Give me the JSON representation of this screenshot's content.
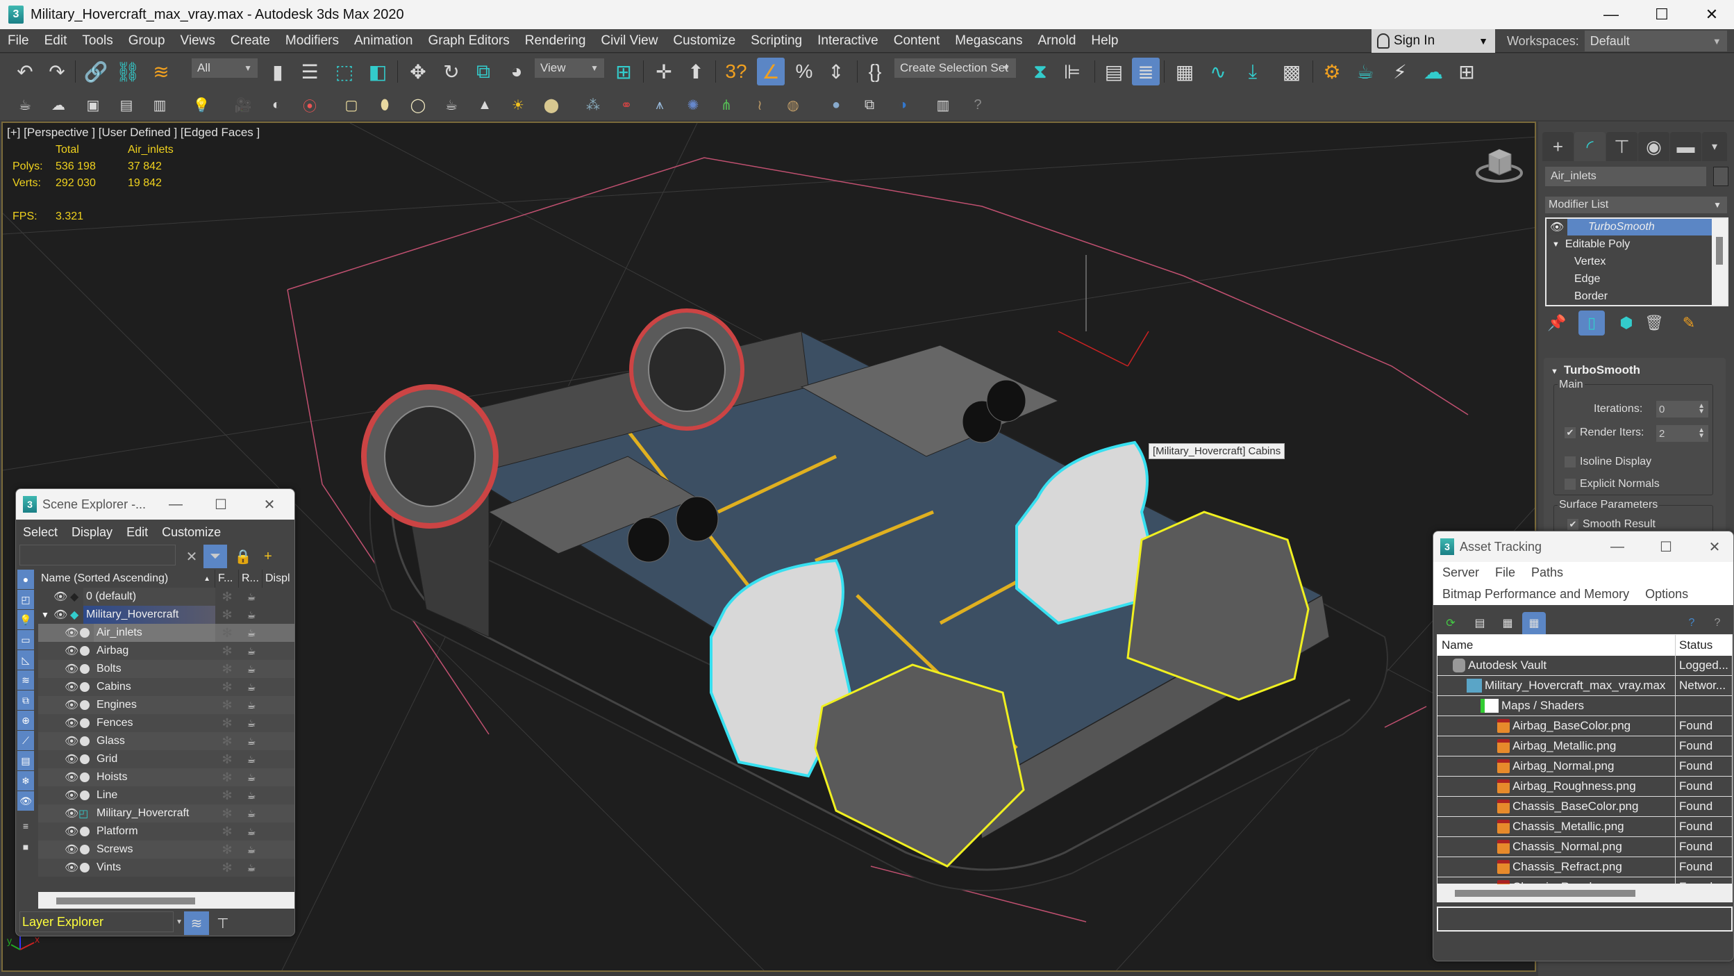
{
  "window": {
    "title": "Military_Hovercraft_max_vray.max - Autodesk 3ds Max 2020",
    "app_icon": "3",
    "minimize": "—",
    "maximize": "☐",
    "close": "✕"
  },
  "menubar": {
    "items": [
      "File",
      "Edit",
      "Tools",
      "Group",
      "Views",
      "Create",
      "Modifiers",
      "Animation",
      "Graph Editors",
      "Rendering",
      "Civil View",
      "Customize",
      "Scripting",
      "Interactive",
      "Content",
      "Megascans",
      "Arnold",
      "Help"
    ],
    "sign_in": "Sign In",
    "workspaces_label": "Workspaces:",
    "workspace_value": "Default"
  },
  "toolbar": {
    "selection_filter": "All",
    "reference_coord": "View",
    "selection_set": "Create Selection Set",
    "icons_row1": [
      "undo-icon",
      "redo-icon",
      "link-icon",
      "unlink-icon",
      "bind-space-warp-icon",
      "select-object-icon",
      "select-by-name-icon",
      "rect-selection-icon",
      "window-crossing-icon",
      "move-icon",
      "rotate-icon",
      "scale-icon",
      "placement-icon",
      "pivot-icon",
      "select-manipulate-icon",
      "keyboard-override-icon",
      "snaps-toggle-icon",
      "angle-snap-icon",
      "percent-snap-icon",
      "spinner-snap-icon",
      "edit-named-sets-icon",
      "mirror-icon",
      "align-icon",
      "scene-explorer-icon",
      "layer-explorer-icon",
      "ribbon-icon",
      "curve-editor-icon",
      "dope-sheet-icon",
      "material-editor-icon",
      "render-setup-icon",
      "rendered-frame-icon",
      "render-production-icon",
      "render-cloud-icon",
      "render-iterative-icon"
    ],
    "icons_row2": [
      "teapot-icon",
      "cloud-icon",
      "render-window-icon",
      "list-icon",
      "list-settings-icon",
      "light-list-icon",
      "camera-icon",
      "physical-camera-icon",
      "target-camera-icon",
      "box-light-icon",
      "dome-icon",
      "sphere-light-icon",
      "teapot-wire-icon",
      "cone-light-icon",
      "sun-icon",
      "disc-light-icon",
      "grid-icon",
      "molecule-icon",
      "tower-icon",
      "ball-icon",
      "grass-icon",
      "fur-icon",
      "displacement-icon",
      "sphere-material-icon",
      "material-browser-icon",
      "material-preview-icon",
      "render-element-icon",
      "help-icon"
    ]
  },
  "viewport": {
    "label": "[+] [Perspective ] [User Defined ] [Edged Faces ]",
    "stats": {
      "col_total": "Total",
      "col_selected": "Air_inlets",
      "polys_label": "Polys:",
      "polys_total": "536 198",
      "polys_selected": "37 842",
      "verts_label": "Verts:",
      "verts_total": "292 030",
      "verts_selected": "19 842",
      "fps_label": "FPS:",
      "fps_value": "3.321"
    },
    "tooltip": "[Military_Hovercraft] Cabins",
    "colors": {
      "stats_text": "#f0d21e",
      "selection_cyan": "#38e0f0",
      "selection_yellow": "#f0f020",
      "deck_blue": "#3c4f63",
      "deck_stripes": "#e0b020"
    }
  },
  "command_panel": {
    "tabs": [
      "create-icon",
      "modify-icon",
      "hierarchy-icon",
      "motion-icon",
      "display-icon",
      "utilities-icon"
    ],
    "object_name": "Air_inlets",
    "modifier_list": "Modifier List",
    "stack": [
      {
        "label": "TurboSmooth",
        "selected": true
      },
      {
        "label": "Editable Poly",
        "expanded": true
      },
      {
        "label": "Vertex"
      },
      {
        "label": "Edge"
      },
      {
        "label": "Border"
      }
    ],
    "rollout": {
      "title": "TurboSmooth",
      "main_group": "Main",
      "iterations_label": "Iterations:",
      "iterations_value": "0",
      "render_iters_label": "Render Iters:",
      "render_iters_value": "2",
      "render_iters_checked": true,
      "isoline_label": "Isoline Display",
      "isoline_checked": false,
      "explicit_normals_label": "Explicit Normals",
      "explicit_normals_checked": false,
      "surface_group": "Surface Parameters",
      "smooth_result_label": "Smooth Result",
      "smooth_result_checked": true
    }
  },
  "scene_explorer": {
    "title": "Scene Explorer -...",
    "menu": [
      "Select",
      "Display",
      "Edit",
      "Customize"
    ],
    "columns": [
      "Name (Sorted Ascending)",
      "F...",
      "R...",
      "Displ"
    ],
    "layers": [
      {
        "name": "0 (default)",
        "type": "layer",
        "level": 0
      },
      {
        "name": "Military_Hovercraft",
        "type": "layer",
        "level": 0,
        "expanded": true,
        "active": true
      }
    ],
    "objects": [
      {
        "name": "Air_inlets",
        "selected": true
      },
      {
        "name": "Airbag"
      },
      {
        "name": "Bolts"
      },
      {
        "name": "Cabins"
      },
      {
        "name": "Engines"
      },
      {
        "name": "Fences"
      },
      {
        "name": "Glass"
      },
      {
        "name": "Grid"
      },
      {
        "name": "Hoists"
      },
      {
        "name": "Line"
      },
      {
        "name": "Military_Hovercraft",
        "group": true
      },
      {
        "name": "Platform"
      },
      {
        "name": "Screws"
      },
      {
        "name": "Vints"
      }
    ],
    "footer_mode": "Layer Explorer"
  },
  "asset_tracking": {
    "title": "Asset Tracking",
    "menu_row1": [
      "Server",
      "File",
      "Paths"
    ],
    "menu_row2": [
      "Bitmap Performance and Memory",
      "Options"
    ],
    "columns": [
      "Name",
      "Status"
    ],
    "rows": [
      {
        "name": "Autodesk Vault",
        "status": "Logged...",
        "icon": "vault",
        "level": 0
      },
      {
        "name": "Military_Hovercraft_max_vray.max",
        "status": "Networ...",
        "icon": "max",
        "level": 1
      },
      {
        "name": "Maps / Shaders",
        "status": "",
        "icon": "folder",
        "level": 2
      },
      {
        "name": "Airbag_BaseColor.png",
        "status": "Found",
        "icon": "png",
        "level": 3
      },
      {
        "name": "Airbag_Metallic.png",
        "status": "Found",
        "icon": "png",
        "level": 3
      },
      {
        "name": "Airbag_Normal.png",
        "status": "Found",
        "icon": "png",
        "level": 3
      },
      {
        "name": "Airbag_Roughness.png",
        "status": "Found",
        "icon": "png",
        "level": 3
      },
      {
        "name": "Chassis_BaseColor.png",
        "status": "Found",
        "icon": "png",
        "level": 3
      },
      {
        "name": "Chassis_Metallic.png",
        "status": "Found",
        "icon": "png",
        "level": 3
      },
      {
        "name": "Chassis_Normal.png",
        "status": "Found",
        "icon": "png",
        "level": 3
      },
      {
        "name": "Chassis_Refract.png",
        "status": "Found",
        "icon": "png",
        "level": 3
      },
      {
        "name": "Chassis_Roughness.png",
        "status": "Found",
        "icon": "png",
        "level": 3
      }
    ]
  }
}
